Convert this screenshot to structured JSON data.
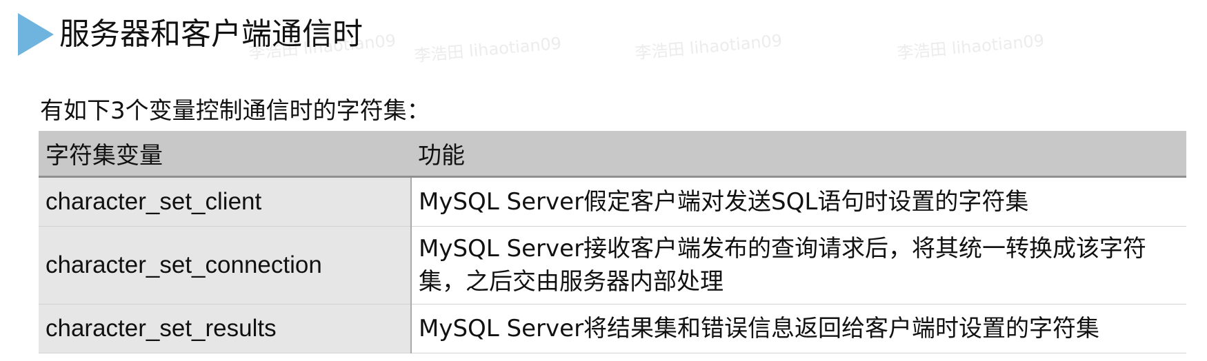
{
  "slide": {
    "title": "服务器和客户端通信时",
    "intro": "有如下3个变量控制通信时的字符集："
  },
  "table": {
    "headers": [
      "字符集变量",
      "功能"
    ],
    "rows": [
      {
        "variable": "character_set_client",
        "function": "MySQL Server假定客户端对发送SQL语句时设置的字符集"
      },
      {
        "variable": "character_set_connection",
        "function": "MySQL Server接收客户端发布的查询请求后，将其统一转换成该字符集，之后交由服务器内部处理"
      },
      {
        "variable": "character_set_results",
        "function": "MySQL Server将结果集和错误信息返回给客户端时设置的字符集"
      }
    ]
  },
  "watermark": {
    "text": "李浩田 lihaotian09"
  },
  "colors": {
    "arrow": "#6fb3df",
    "header_bg": "#c8c8c8",
    "variable_bg": "#e6e6e6"
  }
}
